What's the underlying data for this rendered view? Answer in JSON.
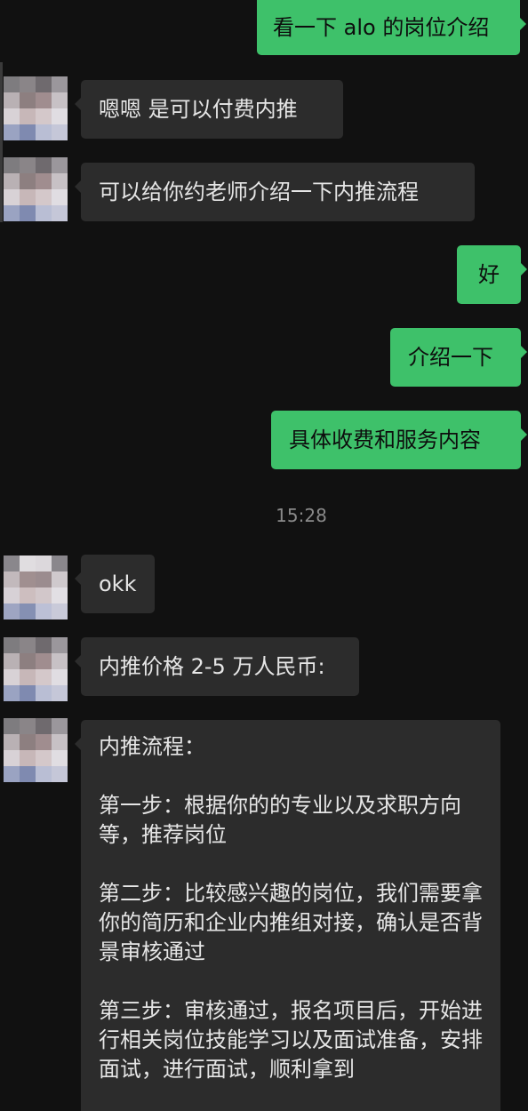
{
  "chat": {
    "timestamp": "15:28",
    "messages": {
      "m1": "看一下 alo 的岗位介绍",
      "m2": "嗯嗯  是可以付费内推",
      "m3": "可以给你约老师介绍一下内推流程",
      "m4": "好",
      "m5": "介绍一下",
      "m6": "具体收费和服务内容",
      "m7": "okk",
      "m8": "内推价格 2-5 万人民币:",
      "m9": {
        "title": "内推流程：",
        "step1": "第一步：根据你的的专业以及求职方向等，推荐岗位",
        "step2": "第二步：比较感兴趣的岗位，我们需要拿你的简历和企业内推组对接，确认是否背景审核通过",
        "step3": "第三步：审核通过，报名项目后，开始进行相关岗位技能学习以及面试准备，安排面试，进行面试，顺利拿到"
      }
    }
  },
  "colors": {
    "background": "#111111",
    "incoming_bubble": "#2c2c2c",
    "outgoing_bubble": "#3ec16a"
  }
}
